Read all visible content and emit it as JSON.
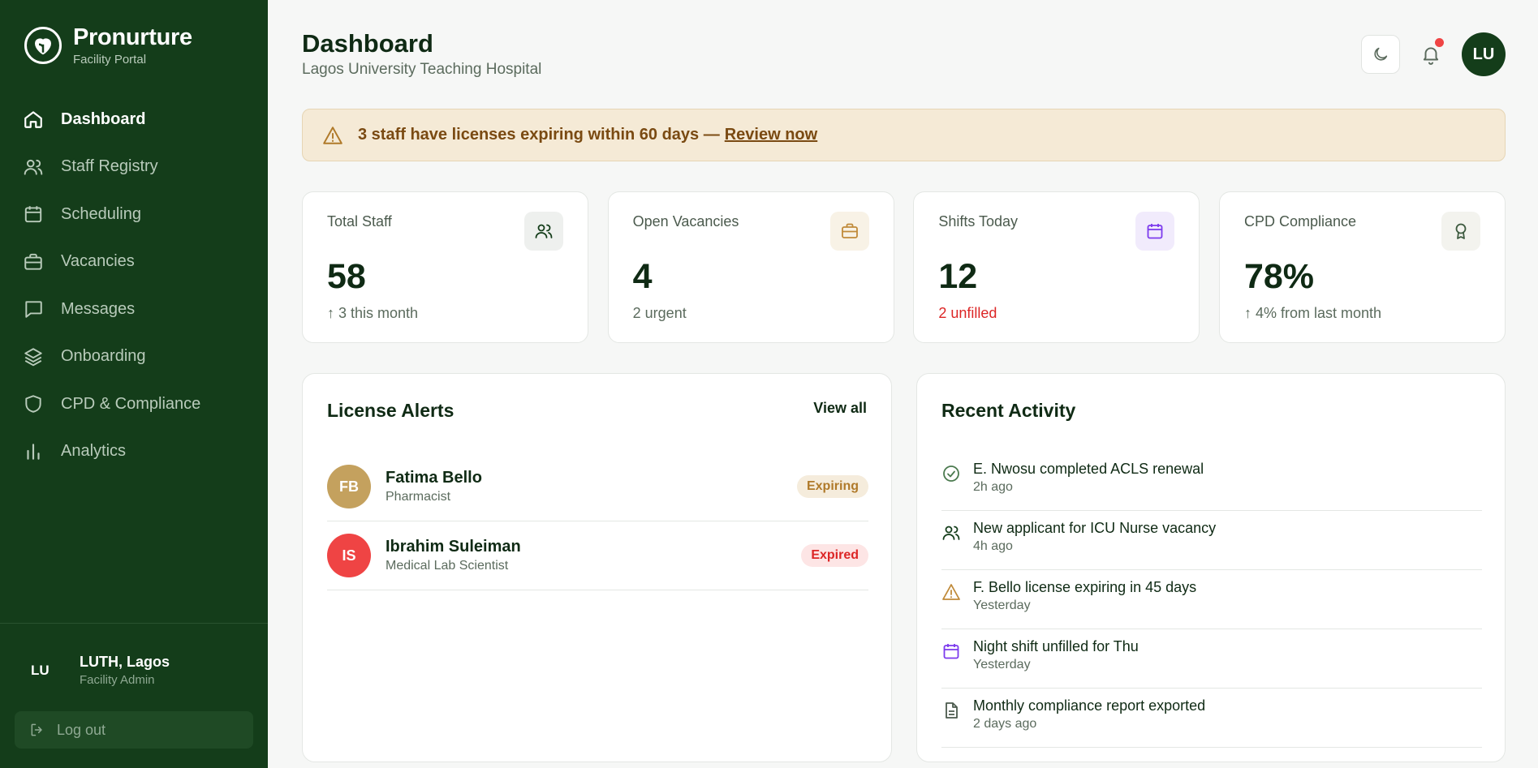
{
  "brand": {
    "name": "Pronurture",
    "subtitle": "Facility Portal"
  },
  "nav": [
    {
      "label": "Dashboard",
      "icon": "home-icon",
      "active": true
    },
    {
      "label": "Staff Registry",
      "icon": "users-icon"
    },
    {
      "label": "Scheduling",
      "icon": "calendar-icon"
    },
    {
      "label": "Vacancies",
      "icon": "briefcase-icon"
    },
    {
      "label": "Messages",
      "icon": "message-icon"
    },
    {
      "label": "Onboarding",
      "icon": "layers-icon"
    },
    {
      "label": "CPD & Compliance",
      "icon": "shield-icon"
    },
    {
      "label": "Analytics",
      "icon": "bar-chart-icon"
    }
  ],
  "user": {
    "initials": "LU",
    "name": "LUTH, Lagos",
    "role": "Facility Admin"
  },
  "logout_label": "Log out",
  "header": {
    "title": "Dashboard",
    "subtitle": "Lagos University Teaching Hospital",
    "avatar_initials": "LU"
  },
  "alert": {
    "text": "3 staff have licenses expiring within 60 days —",
    "link": "Review now"
  },
  "stats": [
    {
      "label": "Total Staff",
      "value": "58",
      "note": "↑ 3 this month",
      "icon": "users-icon",
      "icon_bg": "#eef0ee",
      "icon_color": "#143d1a"
    },
    {
      "label": "Open Vacancies",
      "value": "4",
      "note": "2 urgent",
      "icon": "briefcase-icon",
      "icon_bg": "#f8f2e6",
      "icon_color": "#c08a3a"
    },
    {
      "label": "Shifts Today",
      "value": "12",
      "note": "2 unfilled",
      "icon": "calendar-icon",
      "icon_bg": "#f1ebfc",
      "icon_color": "#7c3aed"
    },
    {
      "label": "CPD Compliance",
      "value": "78%",
      "note": "↑ 4% from last month",
      "icon": "award-icon",
      "icon_bg": "#f3f3ee",
      "icon_color": "#3d5a3f"
    }
  ],
  "license_alerts": {
    "title": "License Alerts",
    "view_all": "View all",
    "items": [
      {
        "initials": "FB",
        "name": "Fatima Bello",
        "role": "Pharmacist",
        "status": "Expiring",
        "avatar_color": "#c4a15e"
      },
      {
        "initials": "IS",
        "name": "Ibrahim Suleiman",
        "role": "Medical Lab Scientist",
        "status": "Expired",
        "avatar_color": "#ef4444"
      }
    ]
  },
  "recent_activity": {
    "title": "Recent Activity",
    "items": [
      {
        "text": "E. Nwosu completed ACLS renewal",
        "time": "2h ago",
        "icon": "check-circle-icon",
        "color": "#4b7a4f"
      },
      {
        "text": "New applicant for ICU Nurse vacancy",
        "time": "4h ago",
        "icon": "users-icon",
        "color": "#143d1a"
      },
      {
        "text": "F. Bello license expiring in 45 days",
        "time": "Yesterday",
        "icon": "warning-icon",
        "color": "#c08a3a"
      },
      {
        "text": "Night shift unfilled for Thu",
        "time": "Yesterday",
        "icon": "calendar-icon",
        "color": "#7c3aed"
      },
      {
        "text": "Monthly compliance report exported",
        "time": "2 days ago",
        "icon": "document-icon",
        "color": "#4b5a4d"
      }
    ]
  }
}
